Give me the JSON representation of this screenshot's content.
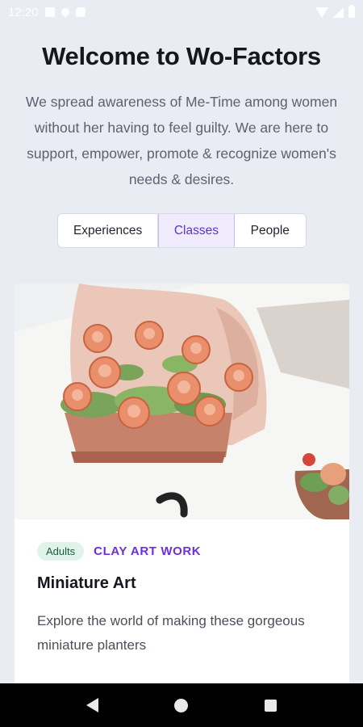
{
  "status_bar": {
    "time": "12:20"
  },
  "header": {
    "title": "Welcome to Wo-Factors",
    "subtitle": "We spread awareness of Me-Time among women without her having to feel guilty. We are here to support, empower, promote & recognize women's needs & desires."
  },
  "tabs": [
    {
      "label": "Experiences",
      "selected": false
    },
    {
      "label": "Classes",
      "selected": true
    },
    {
      "label": "People",
      "selected": false
    }
  ],
  "card": {
    "badge": "Adults",
    "category": "CLAY ART WORK",
    "title": "Miniature Art",
    "description": "Explore the world of making these gorgeous miniature planters"
  },
  "colors": {
    "background": "#e9ecf3",
    "accent": "#6b2fe0",
    "badge_bg": "#dff3ea",
    "badge_text": "#1b5a41"
  },
  "icons": {
    "status_left": [
      "photo-icon",
      "drop-icon",
      "sd-card-icon"
    ],
    "status_right": [
      "wifi-icon",
      "signal-icon",
      "battery-icon"
    ],
    "nav": [
      "back-icon",
      "home-icon",
      "recents-icon"
    ]
  }
}
